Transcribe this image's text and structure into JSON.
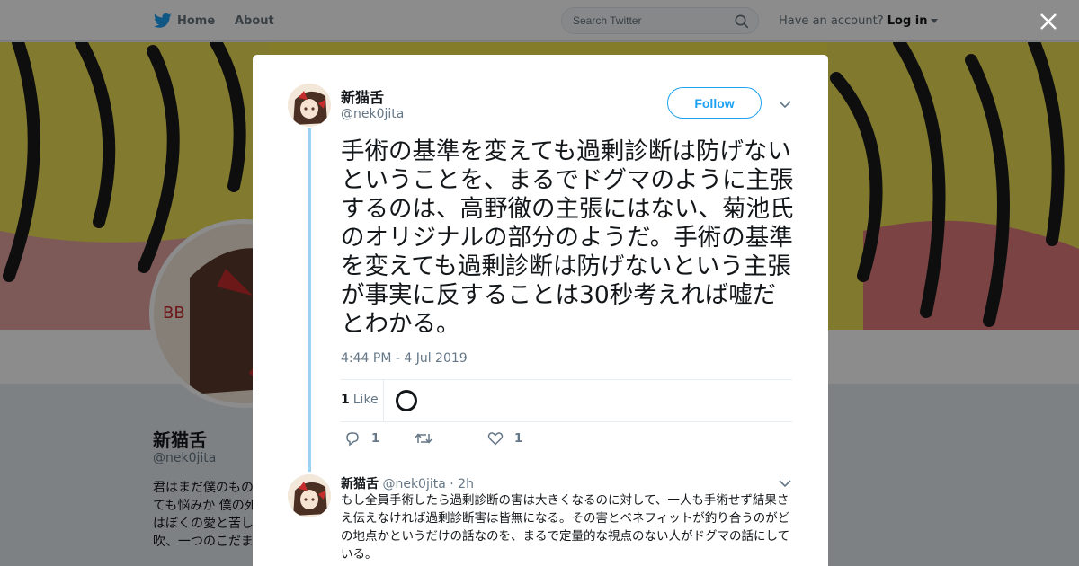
{
  "nav": {
    "home_label": "Home",
    "about_label": "About",
    "search_placeholder": "Search Twitter",
    "account_prompt": "Have an account?",
    "login_label": "Log in"
  },
  "profile": {
    "name": "新猫舌",
    "handle": "@nek0jita",
    "bio": "君はまだ僕のもの\nても悩みか 僕の死\nはぼくの愛と苦し\n吹、一つのこだま"
  },
  "tweet": {
    "author_name": "新猫舌",
    "author_handle": "@nek0jita",
    "follow_label": "Follow",
    "text": "手術の基準を変えても過剰診断は防げないということを、まるでドグマのように主張するのは、高野徹の主張にはない、菊池氏のオリジナルの部分のようだ。手術の基準を変えても過剰診断は防げないという主張が事実に反することは30秒考えれば嘘だとわかる。",
    "timestamp": "4:44 PM - 4 Jul 2019",
    "like_count": "1",
    "like_label": "Like",
    "reply_count": "1",
    "retweet_count": "",
    "favorite_count": "1"
  },
  "reply": {
    "author_name": "新猫舌",
    "author_handle": "@nek0jita",
    "time": "· 2h",
    "text": "もし全員手術したら過剰診断の害は大きくなるのに対して、一人も手術せず結果さえ伝えなければ過剰診断害は皆無になる。その害とベネフィットが釣り合うのがどの地点かというだけの話なのを、まるで定量的な視点のない人がドグマの話にしている。"
  },
  "colors": {
    "accent": "#1da1f2",
    "thread_line": "#9bd3f3",
    "banner_yellow": "#f0e24b"
  },
  "icons": [
    "twitter-bird-icon",
    "search-icon",
    "close-icon",
    "chevron-down-icon",
    "reply-icon",
    "retweet-icon",
    "heart-icon"
  ]
}
